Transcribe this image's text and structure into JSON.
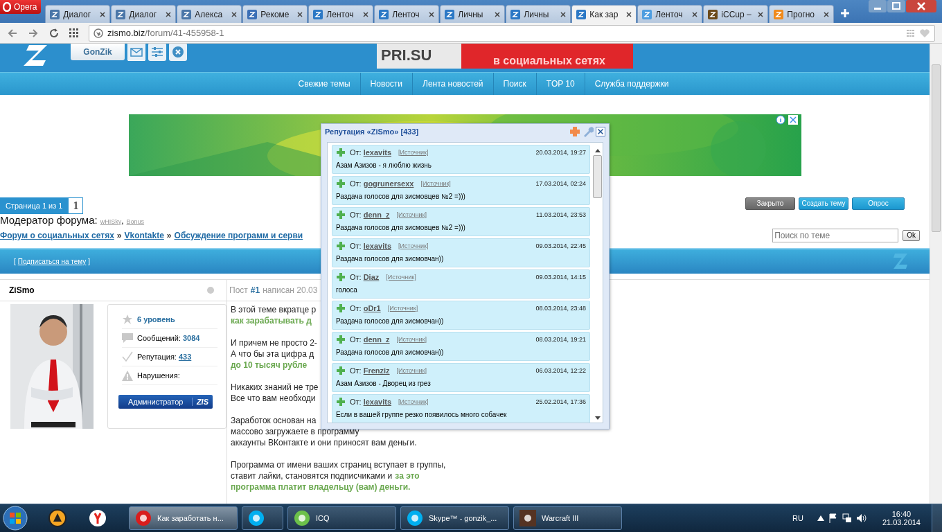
{
  "browser": {
    "menu_label": "Opera",
    "tabs": [
      {
        "label": "Диалог",
        "kind": "chat",
        "selected": false
      },
      {
        "label": "Диалог",
        "kind": "chat",
        "selected": false
      },
      {
        "label": "Алекса",
        "kind": "vk",
        "selected": false
      },
      {
        "label": "Рекоме",
        "kind": "video",
        "selected": false
      },
      {
        "label": "Ленточ",
        "kind": "z",
        "selected": false
      },
      {
        "label": "Ленточ",
        "kind": "z",
        "selected": false
      },
      {
        "label": "Личны",
        "kind": "z",
        "selected": false
      },
      {
        "label": "Личны",
        "kind": "z",
        "selected": false
      },
      {
        "label": "Как зар",
        "kind": "z",
        "selected": true
      },
      {
        "label": "Ленточ",
        "kind": "spin",
        "selected": false
      },
      {
        "label": "iCCup –",
        "kind": "cup",
        "selected": false
      },
      {
        "label": "Прогно",
        "kind": "orange",
        "selected": false
      }
    ],
    "address": {
      "host": "zismo.biz",
      "path": "/forum/41-455958-1"
    }
  },
  "header": {
    "user_button": "GonZik",
    "banner_top": "PRI.SU",
    "banner_bottom": "в социальных сетях"
  },
  "nav": [
    "Свежие темы",
    "Новости",
    "Лента новостей",
    "Поиск",
    "TOP 10",
    "Служба поддержки"
  ],
  "pager": {
    "label": "Страница 1 из 1",
    "page": "1"
  },
  "moderators": {
    "label": "Модератор форума:",
    "names": [
      "wHISky",
      "Bonus"
    ],
    "separator": ","
  },
  "breadcrumb": [
    {
      "text": "Форум о социальных сетях",
      "kind": "link"
    },
    {
      "text": "»",
      "kind": "sep"
    },
    {
      "text": "Vkontakte",
      "kind": "link"
    },
    {
      "text": "»",
      "kind": "sep"
    },
    {
      "text": "Обсуждение программ и серви",
      "kind": "link"
    }
  ],
  "actions": [
    {
      "label": "Закрыто",
      "kind": "closed"
    },
    {
      "label": "Создать тему",
      "kind": "primary"
    },
    {
      "label": "Опрос",
      "kind": "primary"
    }
  ],
  "topic_search": {
    "placeholder": "Поиск по теме",
    "button": "Ok"
  },
  "subscribe": {
    "open": "[",
    "link": "Подписаться на тему",
    "close": "]"
  },
  "author": {
    "name": "ZiSmo",
    "online": false,
    "level": "6 уровень",
    "posts_label": "Сообщений:",
    "posts": "3084",
    "rep_label": "Репутация:",
    "rep": "433",
    "warn_label": "Нарушения:",
    "role": "Администратор",
    "role_tag": "ZIS"
  },
  "post": {
    "header": [
      {
        "text": "Пост",
        "bold": false
      },
      {
        "text": "#1",
        "bold": true
      },
      {
        "text": "написан 20.03",
        "bold": false
      }
    ],
    "paragraphs": [
      [
        [
          {
            "text": "В этой теме вкратце р",
            "accent": false
          }
        ],
        [
          {
            "text": "как зарабатывать д",
            "accent": true
          }
        ]
      ],
      [
        [
          {
            "text": "И причем не просто 2-",
            "accent": false
          }
        ],
        [
          {
            "text": "А что бы эта цифра д",
            "accent": false
          }
        ],
        [
          {
            "text": "до 10 тысяч рубле",
            "accent": true
          }
        ]
      ],
      [
        [
          {
            "text": "Никаких знаний не тре",
            "accent": false
          }
        ],
        [
          {
            "text": "Все что вам необходи",
            "accent": false
          }
        ]
      ],
      [
        [
          {
            "text": "Заработок основан на",
            "accent": false
          }
        ],
        [
          {
            "text": "массово загружаете в программу",
            "accent": false
          }
        ],
        [
          {
            "text": "аккаунты ВКонтакте и они приносят вам деньги.",
            "accent": false
          }
        ]
      ],
      [
        [
          {
            "text": "Программа от имени ваших страниц вступает в группы,",
            "accent": false
          }
        ],
        [
          {
            "text": "ставит лайки, становятся подписчиками и",
            "accent": false
          },
          {
            "text": "за это",
            "accent": true
          }
        ],
        [
          {
            "text": "программа платит владельцу (вам) деньги.",
            "accent": true
          }
        ]
      ]
    ]
  },
  "reputation": {
    "title": "Репутация «ZiSmo» [433]",
    "entries": [
      {
        "from_label": "От:",
        "user": "lexavits",
        "source": "[Источник]",
        "date": "20.03.2014, 19:27",
        "text": "Азам Азизов - я люблю жизнь"
      },
      {
        "from_label": "От:",
        "user": "gogrunersexx",
        "source": "[Источник]",
        "date": "17.03.2014, 02:24",
        "text": "Раздача голосов для зисмовцев №2 =)))"
      },
      {
        "from_label": "От:",
        "user": "denn_z",
        "source": "[Источник]",
        "date": "11.03.2014, 23:53",
        "text": "Раздача голосов для зисмовцев №2 =)))"
      },
      {
        "from_label": "От:",
        "user": "lexavits",
        "source": "[Источник]",
        "date": "09.03.2014, 22:45",
        "text": "Раздача голосов для зисмовчан))"
      },
      {
        "from_label": "От:",
        "user": "Diaz",
        "source": "[Источник]",
        "date": "09.03.2014, 14:15",
        "text": "голоса"
      },
      {
        "from_label": "От:",
        "user": "oDr1",
        "source": "[Источник]",
        "date": "08.03.2014, 23:48",
        "text": "Раздача голосов для зисмовчан))"
      },
      {
        "from_label": "От:",
        "user": "denn_z",
        "source": "[Источник]",
        "date": "08.03.2014, 19:21",
        "text": "Раздача голосов для зисмовчан))"
      },
      {
        "from_label": "От:",
        "user": "Frenziz",
        "source": "[Источник]",
        "date": "06.03.2014, 12:22",
        "text": "Азам Азизов - Дворец из грез"
      },
      {
        "from_label": "От:",
        "user": "lexavits",
        "source": "[Источник]",
        "date": "25.02.2014, 17:36",
        "text": "Если в вашей группе резко появилось много собачек"
      }
    ]
  },
  "taskbar": {
    "tasks": [
      {
        "label": "Как заработать н...",
        "kind": "opera",
        "selected": true
      },
      {
        "kind": "skype",
        "selected": false
      },
      {
        "label": "ICQ",
        "kind": "icq",
        "selected": false
      },
      {
        "label": "Skype™ - gonzik_...",
        "kind": "skype",
        "selected": false
      },
      {
        "label": "Warcraft III",
        "kind": "game",
        "selected": false
      }
    ],
    "lang": "RU",
    "time": "16:40",
    "date": "21.03.2014"
  }
}
